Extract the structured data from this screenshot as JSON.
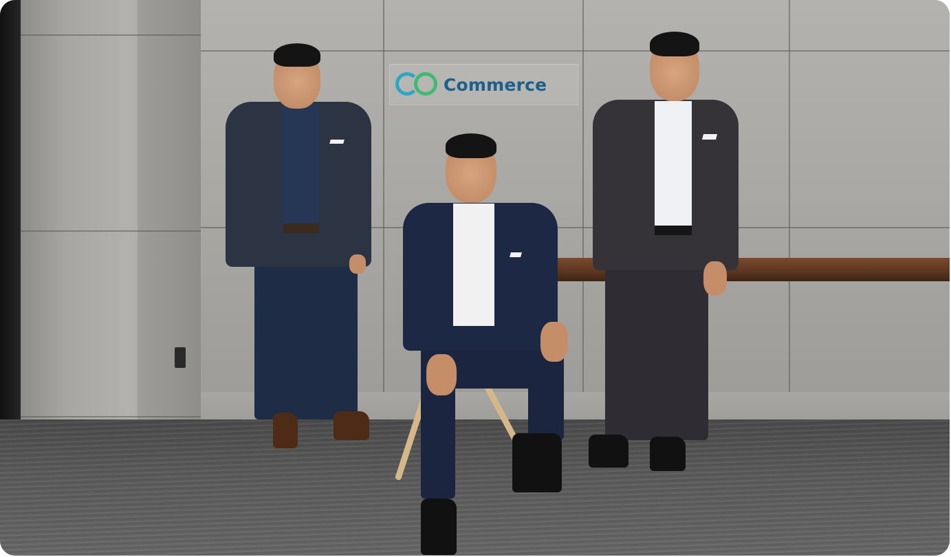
{
  "photo": {
    "subject": "",
    "sign": {
      "logo_text": "Commerce",
      "logo_prefix": "GO",
      "colors": {
        "g_ring": "#2aa7c2",
        "o_ring": "#3dbb72",
        "wordmark": "#1f5f8c"
      }
    }
  }
}
